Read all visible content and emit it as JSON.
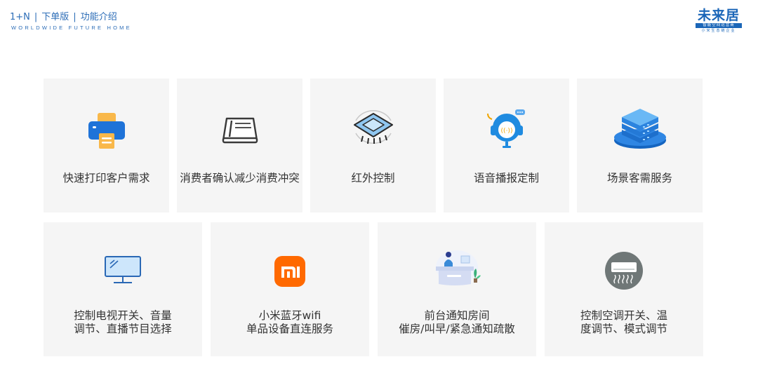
{
  "header": {
    "crumb_1": "1+N",
    "crumb_2": "下单版",
    "crumb_3": "功能介绍",
    "tagline": "WORLDWIDE FUTURE HOME"
  },
  "logo": {
    "name": "未来居",
    "bar_text": "智能空间运营商",
    "sub_text": "小米生态链企业"
  },
  "row1": [
    {
      "label": "快速打印客户需求",
      "icon": "printer-icon"
    },
    {
      "label": "消费者确认减少消费冲突",
      "icon": "scanner-icon"
    },
    {
      "label": "红外控制",
      "icon": "chip-icon"
    },
    {
      "label": "语音播报定制",
      "icon": "headset-icon"
    },
    {
      "label": "场景客需服务",
      "icon": "server-stack-icon"
    }
  ],
  "row2": [
    {
      "line1": "控制电视开关、音量",
      "line2": "调节、直播节目选择",
      "icon": "monitor-icon"
    },
    {
      "line1": "小米蓝牙wifi",
      "line2": "单品设备直连服务",
      "icon": "mi-logo-icon"
    },
    {
      "line1": "前台通知房间",
      "line2": "催房/叫早/紧急通知疏散",
      "icon": "reception-desk-icon"
    },
    {
      "line1": "控制空调开关、温",
      "line2": "度调节、模式调节",
      "icon": "air-conditioner-icon"
    }
  ],
  "colors": {
    "accent": "#2c6db7",
    "card_bg": "#f5f5f5",
    "mi_orange": "#ff6900"
  }
}
